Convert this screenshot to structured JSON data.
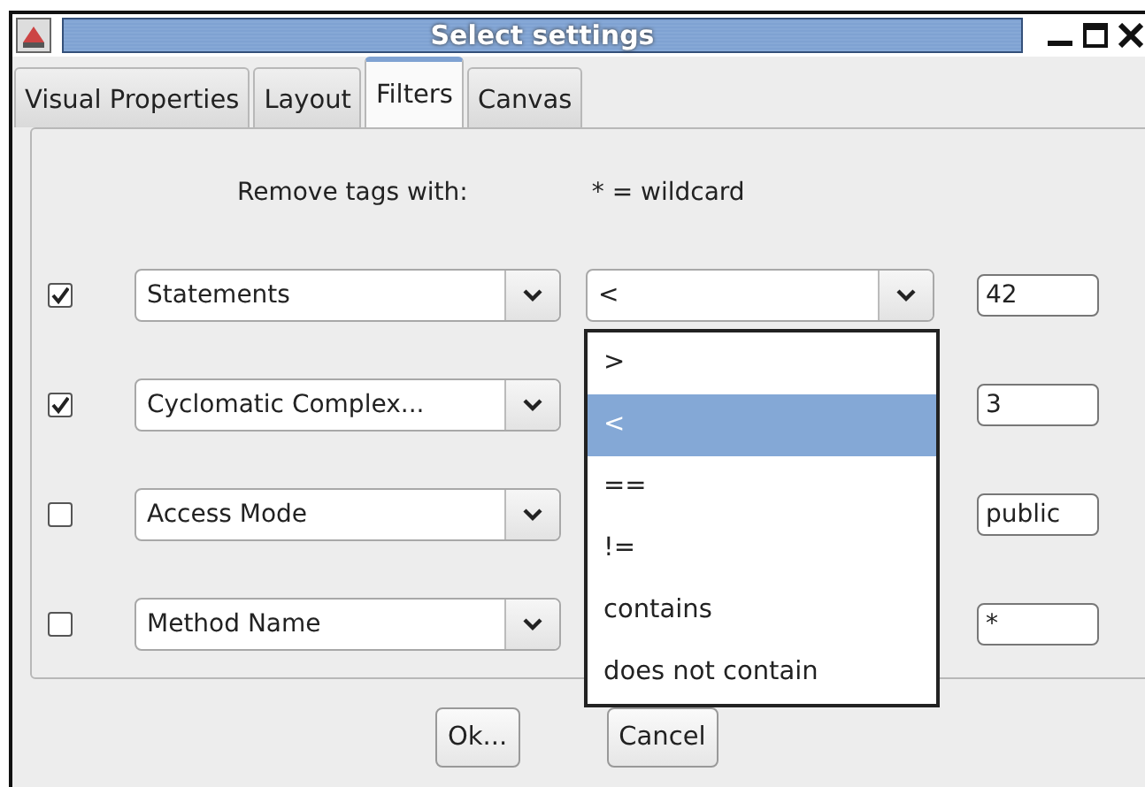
{
  "window": {
    "title": "Select settings"
  },
  "tabs": [
    {
      "label": "Visual Properties",
      "selected": false
    },
    {
      "label": "Layout",
      "selected": false
    },
    {
      "label": "Filters",
      "selected": true
    },
    {
      "label": "Canvas",
      "selected": false
    }
  ],
  "header": {
    "left": "Remove tags with:",
    "right": "* = wildcard"
  },
  "rows": [
    {
      "checked": true,
      "field": "Statements",
      "operator": "<",
      "value": "42"
    },
    {
      "checked": true,
      "field": "Cyclomatic Complex...",
      "value": "3"
    },
    {
      "checked": false,
      "field": "Access Mode",
      "value": "public"
    },
    {
      "checked": false,
      "field": "Method Name",
      "value": "*"
    }
  ],
  "operator_menu": [
    {
      "label": ">",
      "selected": false
    },
    {
      "label": "<",
      "selected": true
    },
    {
      "label": "==",
      "selected": false
    },
    {
      "label": "!=",
      "selected": false
    },
    {
      "label": "contains",
      "selected": false
    },
    {
      "label": "does not contain",
      "selected": false
    }
  ],
  "buttons": [
    "Ok...",
    "Cancel"
  ]
}
